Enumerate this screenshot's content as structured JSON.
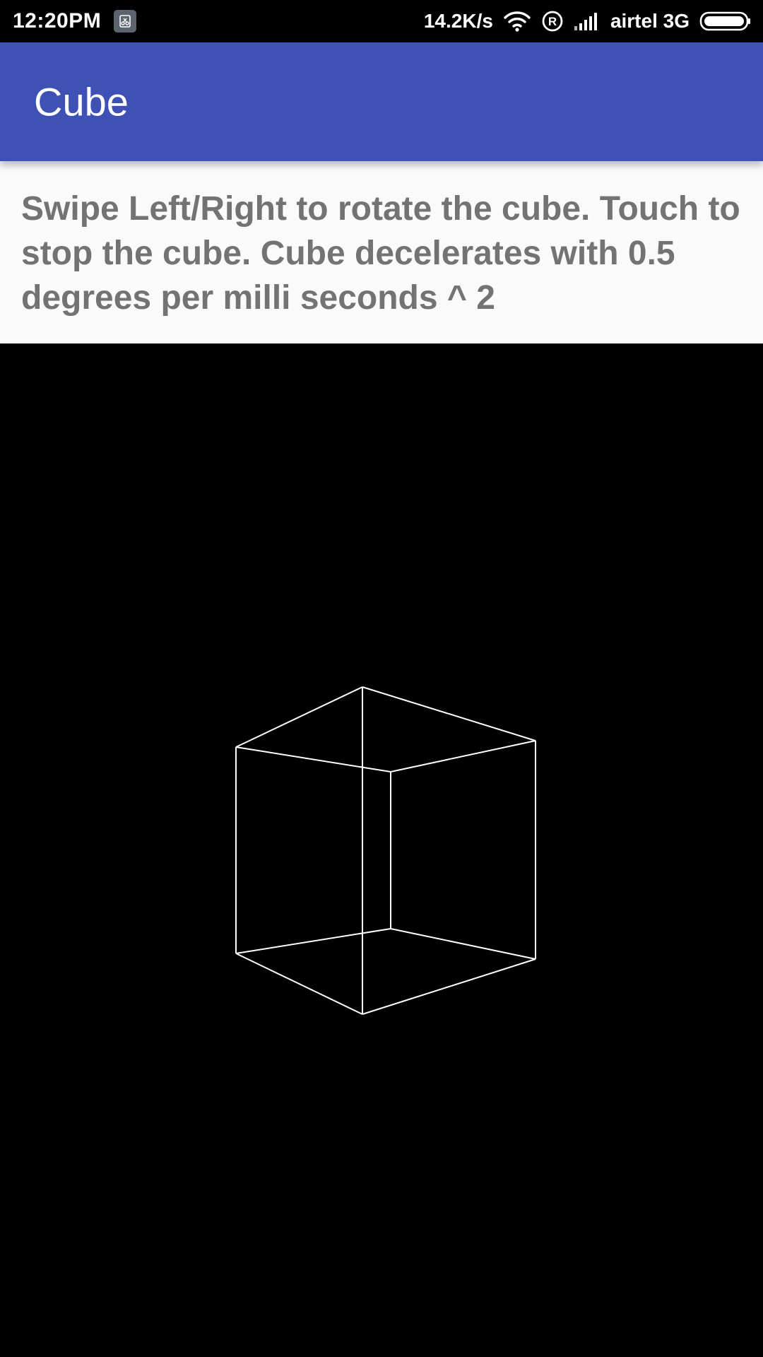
{
  "status_bar": {
    "time": "12:20PM",
    "notification_icon": "screenshot-icon",
    "net_speed": "14.2K/s",
    "wifi_icon": "wifi-icon",
    "roaming_icon": "registered-roaming-icon",
    "signal_icon": "cell-signal-icon",
    "carrier": "airtel 3G",
    "battery_icon": "battery-icon"
  },
  "app_bar": {
    "title": "Cube",
    "color": "#3f51b5"
  },
  "instructions": {
    "text": "Swipe Left/Right to rotate the cube. Touch to stop the cube. Cube decelerates with 0.5 degrees per milli seconds ^ 2"
  },
  "canvas": {
    "background": "#000000",
    "cube_color": "#ffffff"
  }
}
